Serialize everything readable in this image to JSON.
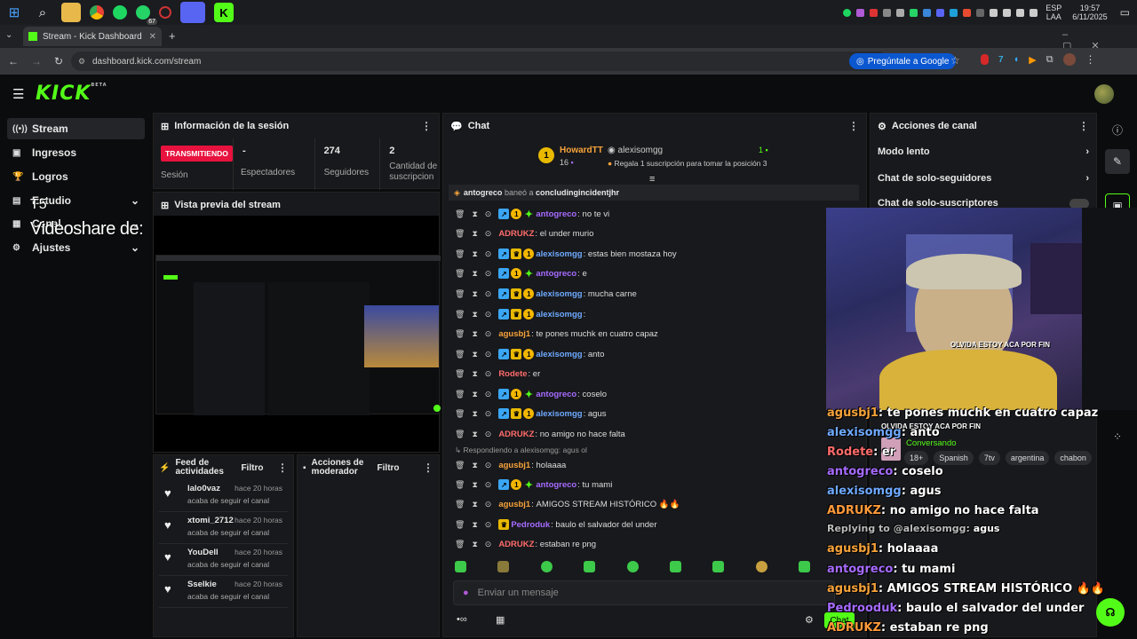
{
  "taskbar": {
    "lang_top": "ESP",
    "lang_bottom": "LAA",
    "time": "19:57",
    "date": "6/11/2025",
    "whatsapp_count": "67"
  },
  "browser": {
    "tab_title": "Stream - Kick Dashboard",
    "url": "dashboard.kick.com/stream",
    "ask_google": "Pregúntale a Google"
  },
  "brand": {
    "name": "KICK",
    "beta": "BETA"
  },
  "sidebar": {
    "items": [
      {
        "label": "Stream",
        "icon": "broadcast-icon"
      },
      {
        "label": "Ingresos",
        "icon": "wallet-icon"
      },
      {
        "label": "Logros",
        "icon": "trophy-icon"
      },
      {
        "label": "Estudio",
        "icon": "studio-icon"
      },
      {
        "label": "Canal",
        "icon": "channel-icon"
      },
      {
        "label": "Ajustes",
        "icon": "gear-icon"
      }
    ],
    "overlay_text": "Videoshare de:",
    "overlay_small": "T5"
  },
  "session": {
    "title": "Información de la sesión",
    "status": "TRANSMITIENDO",
    "status_label": "Sesión",
    "viewers_value": "-",
    "viewers_label": "Espectadores",
    "followers_value": "274",
    "followers_label": "Seguidores",
    "subs_value": "2",
    "subs_label": "Cantidad de suscripcion"
  },
  "preview": {
    "title": "Vista previa del stream"
  },
  "feed": {
    "title": "Feed de actividades",
    "filter": "Filtro",
    "items": [
      {
        "user": "lalo0vaz",
        "time": "hace 20 horas",
        "action": "acaba de seguir el canal"
      },
      {
        "user": "xtomi_2712",
        "time": "hace 20 horas",
        "action": "acaba de seguir el canal"
      },
      {
        "user": "YouDell",
        "time": "hace 20 horas",
        "action": "acaba de seguir el canal"
      },
      {
        "user": "Sselkie",
        "time": "hace 20 horas",
        "action": "acaba de seguir el canal"
      }
    ]
  },
  "mod": {
    "title": "Acciones de moderador",
    "filter": "Filtro"
  },
  "chat": {
    "title": "Chat",
    "top_gifter": "HowardTT",
    "top_rank": "1",
    "top_count": "16",
    "gift_user": "alexisomgg",
    "gift_count": "1",
    "gift_text": "Regala 1 suscripción para tomar la posición 3",
    "ban_mod": "antogreco",
    "ban_text": "baneó a",
    "ban_target": "concludingincidentjhr",
    "reply_note": "Respondiendo a alexisomgg: agus ol",
    "input_placeholder": "Enviar un mensaje",
    "send": "Chat",
    "messages": [
      {
        "user": "antogreco",
        "color": "#a66bff",
        "text": "no te vi",
        "badges": [
          "blue",
          "coin",
          "green"
        ]
      },
      {
        "user": "ADRUKZ",
        "color": "#ff6b6b",
        "text": "el under murio",
        "badges": []
      },
      {
        "user": "alexisomgg",
        "color": "#6ea9ff",
        "text": "estas bien mostaza hoy",
        "badges": [
          "blue",
          "gold",
          "coin"
        ]
      },
      {
        "user": "antogreco",
        "color": "#a66bff",
        "text": "e",
        "badges": [
          "blue",
          "coin",
          "green"
        ]
      },
      {
        "user": "alexisomgg",
        "color": "#6ea9ff",
        "text": "mucha carne",
        "badges": [
          "blue",
          "gold",
          "coin"
        ]
      },
      {
        "user": "alexisomgg",
        "color": "#6ea9ff",
        "text": "",
        "badges": [
          "blue",
          "gold",
          "coin"
        ]
      },
      {
        "user": "agusbj1",
        "color": "#f7a33a",
        "text": "te pones muchk en cuatro capaz",
        "badges": []
      },
      {
        "user": "alexisomgg",
        "color": "#6ea9ff",
        "text": "anto",
        "badges": [
          "blue",
          "gold",
          "coin"
        ]
      },
      {
        "user": "Rodete",
        "color": "#ff6b6b",
        "text": "er",
        "badges": []
      },
      {
        "user": "antogreco",
        "color": "#a66bff",
        "text": "coselo",
        "badges": [
          "blue",
          "coin",
          "green"
        ]
      },
      {
        "user": "alexisomgg",
        "color": "#6ea9ff",
        "text": "agus",
        "badges": [
          "blue",
          "gold",
          "coin"
        ]
      },
      {
        "user": "ADRUKZ",
        "color": "#ff6b6b",
        "text": "no amigo no hace falta",
        "badges": []
      },
      {
        "user": "agusbj1",
        "color": "#f7a33a",
        "text": "holaaaa",
        "badges": []
      },
      {
        "user": "antogreco",
        "color": "#a66bff",
        "text": "tu mami",
        "badges": [
          "blue",
          "coin",
          "green"
        ]
      },
      {
        "user": "agusbj1",
        "color": "#f7a33a",
        "text": "AMIGOS STREAM HISTÓRICO 🔥🔥",
        "badges": []
      },
      {
        "user": "Pedroduk",
        "color": "#a66bff",
        "text": "baulo el salvador del under",
        "badges": [
          "gold"
        ]
      },
      {
        "user": "ADRUKZ",
        "color": "#ff6b6b",
        "text": "estaban re png",
        "badges": []
      }
    ]
  },
  "actions": {
    "title": "Acciones de canal",
    "items": [
      "Modo lento",
      "Chat de solo-seguidores",
      "Chat de solo-suscriptores"
    ]
  },
  "overlay": {
    "caption1": "OLVIDA ESTOY ACA POR FIN",
    "status": "Conversando",
    "tags": [
      "18+",
      "Spanish",
      "7tv",
      "argentina",
      "chabon"
    ],
    "lines": [
      {
        "user": "agusbj1",
        "color": "#f7a33a",
        "text": "te pones muchk en cuatro capaz"
      },
      {
        "user": "alexisomgg",
        "color": "#6ea9ff",
        "text": "anto"
      },
      {
        "user": "Rodete",
        "color": "#ff6b6b",
        "text": "er"
      },
      {
        "user": "antogreco",
        "color": "#a66bff",
        "text": "coselo"
      },
      {
        "user": "alexisomgg",
        "color": "#6ea9ff",
        "text": "agus"
      },
      {
        "user": "ADRUKZ",
        "color": "#ff9a3a",
        "text": "no amigo no hace falta"
      },
      {
        "user": "Replying to @alexisomgg:",
        "color": "#bbbbbb",
        "text": "agus"
      },
      {
        "user": "agusbj1",
        "color": "#f7a33a",
        "text": "holaaaa"
      },
      {
        "user": "antogreco",
        "color": "#a66bff",
        "text": "tu mami"
      },
      {
        "user": "agusbj1",
        "color": "#f7a33a",
        "text": "AMIGOS STREAM HISTÓRICO 🔥🔥"
      },
      {
        "user": "Pedrooduk",
        "color": "#a66bff",
        "text": "baulo el salvador del under"
      },
      {
        "user": "ADRUKZ",
        "color": "#ff9a3a",
        "text": "estaban re png"
      }
    ]
  }
}
